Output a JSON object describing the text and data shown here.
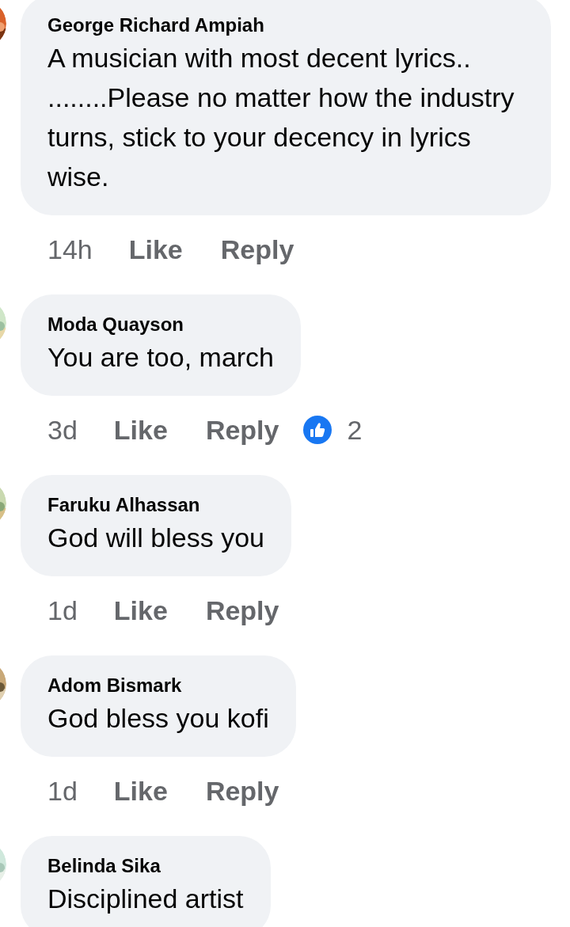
{
  "comments": [
    {
      "name": "George Richard Ampiah",
      "text": "A musician with most decent lyrics.. ........Please no matter how the industry turns, stick to your decency in lyrics wise.",
      "time": "14h",
      "like": "Like",
      "reply": "Reply"
    },
    {
      "name": "Moda Quayson",
      "text": "You are too, march",
      "time": "3d",
      "like": "Like",
      "reply": "Reply",
      "reactions": "2"
    },
    {
      "name": "Faruku Alhassan",
      "text": "God will bless you",
      "time": "1d",
      "like": "Like",
      "reply": "Reply"
    },
    {
      "name": "Adom Bismark",
      "text": "God bless you kofi",
      "time": "1d",
      "like": "Like",
      "reply": "Reply"
    },
    {
      "name": "Belinda Sika",
      "text": "Disciplined artist"
    }
  ]
}
